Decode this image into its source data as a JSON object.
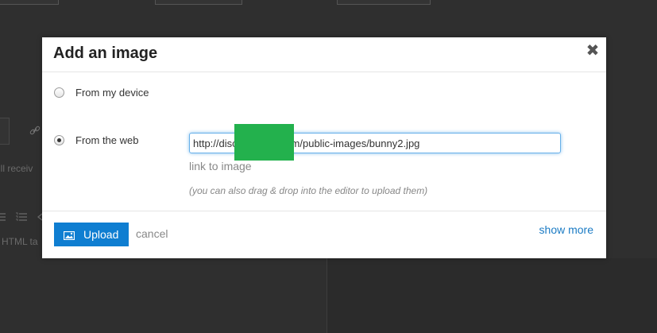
{
  "background": {
    "snippet_text_1": "ill receiv",
    "snippet_text_2": "HTML ta"
  },
  "dialog": {
    "title": "Add an image",
    "close_glyph": "✖",
    "options": [
      {
        "label": "From my device",
        "selected": false
      },
      {
        "label": "From the web",
        "selected": true
      }
    ],
    "url_value": "http://disc              .com/public-images/bunny2.jpg",
    "link_hint": "link to image",
    "drag_note": "(you can also drag & drop into the editor to upload them)",
    "upload_label": "Upload",
    "cancel_label": "cancel",
    "show_more_label": "show more"
  },
  "colors": {
    "primary_button": "#0f7ed1",
    "link": "#1b7bc4",
    "redaction": "#23b14d",
    "focus_ring": "#66afe9"
  },
  "icons": {
    "close": "close-icon",
    "upload": "image-icon"
  }
}
